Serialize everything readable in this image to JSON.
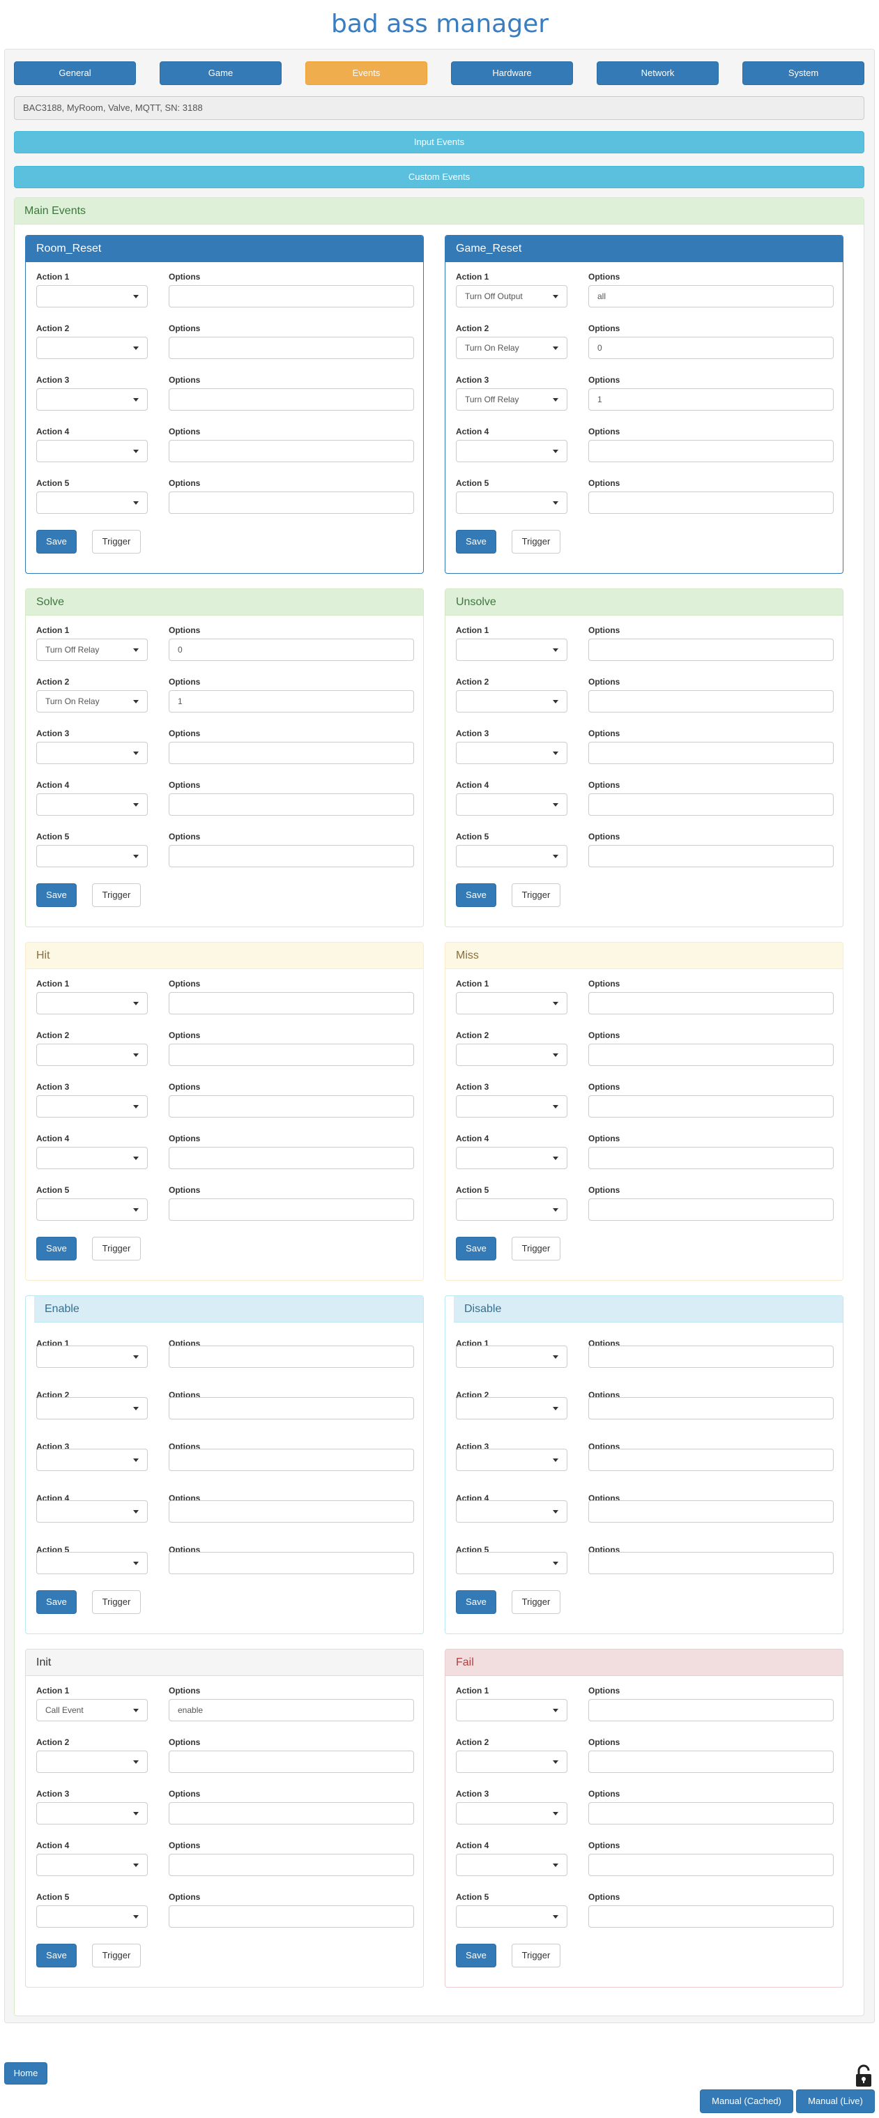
{
  "app": {
    "logo_text": "bad ass manager"
  },
  "nav": [
    "General",
    "Game",
    "Events",
    "Hardware",
    "Network",
    "System"
  ],
  "nav_active": "Events",
  "device_info": "BAC3188, MyRoom, Valve, MQTT, SN: 3188",
  "input_events_label": "Input Events",
  "custom_events_label": "Custom Events",
  "main_events_title": "Main Events",
  "labels": {
    "options": "Options",
    "save": "Save",
    "trigger": "Trigger"
  },
  "panels": [
    {
      "title": "Room_Reset",
      "actions": [
        {
          "label": "Action 1",
          "select": "",
          "option": ""
        },
        {
          "label": "Action 2",
          "select": "",
          "option": ""
        },
        {
          "label": "Action 3",
          "select": "",
          "option": ""
        },
        {
          "label": "Action 4",
          "select": "",
          "option": ""
        },
        {
          "label": "Action 5",
          "select": "",
          "option": ""
        }
      ]
    },
    {
      "title": "Game_Reset",
      "actions": [
        {
          "label": "Action 1",
          "select": "Turn Off Output",
          "option": "all"
        },
        {
          "label": "Action 2",
          "select": "Turn On Relay",
          "option": "0"
        },
        {
          "label": "Action 3",
          "select": "Turn Off Relay",
          "option": "1"
        },
        {
          "label": "Action 4",
          "select": "",
          "option": ""
        },
        {
          "label": "Action 5",
          "select": "",
          "option": ""
        }
      ]
    },
    {
      "title": "Solve",
      "actions": [
        {
          "label": "Action 1",
          "select": "Turn Off Relay",
          "option": "0"
        },
        {
          "label": "Action 2",
          "select": "Turn On Relay",
          "option": "1"
        },
        {
          "label": "Action 3",
          "select": "",
          "option": ""
        },
        {
          "label": "Action 4",
          "select": "",
          "option": ""
        },
        {
          "label": "Action 5",
          "select": "",
          "option": ""
        }
      ]
    },
    {
      "title": "Unsolve",
      "actions": [
        {
          "label": "Action 1",
          "select": "",
          "option": ""
        },
        {
          "label": "Action 2",
          "select": "",
          "option": ""
        },
        {
          "label": "Action 3",
          "select": "",
          "option": ""
        },
        {
          "label": "Action 4",
          "select": "",
          "option": ""
        },
        {
          "label": "Action 5",
          "select": "",
          "option": ""
        }
      ]
    },
    {
      "title": "Hit",
      "actions": [
        {
          "label": "Action 1",
          "select": "",
          "option": ""
        },
        {
          "label": "Action 2",
          "select": "",
          "option": ""
        },
        {
          "label": "Action 3",
          "select": "",
          "option": ""
        },
        {
          "label": "Action 4",
          "select": "",
          "option": ""
        },
        {
          "label": "Action 5",
          "select": "",
          "option": ""
        }
      ]
    },
    {
      "title": "Miss",
      "actions": [
        {
          "label": "Action 1",
          "select": "",
          "option": ""
        },
        {
          "label": "Action 2",
          "select": "",
          "option": ""
        },
        {
          "label": "Action 3",
          "select": "",
          "option": ""
        },
        {
          "label": "Action 4",
          "select": "",
          "option": ""
        },
        {
          "label": "Action 5",
          "select": "",
          "option": ""
        }
      ]
    },
    {
      "title": "Enable",
      "actions": [
        {
          "label": "Action 1",
          "select": "",
          "option": ""
        },
        {
          "label": "Action 2",
          "select": "",
          "option": ""
        },
        {
          "label": "Action 3",
          "select": "",
          "option": ""
        },
        {
          "label": "Action 4",
          "select": "",
          "option": ""
        },
        {
          "label": "Action 5",
          "select": "",
          "option": ""
        }
      ]
    },
    {
      "title": "Disable",
      "actions": [
        {
          "label": "Action 1",
          "select": "",
          "option": ""
        },
        {
          "label": "Action 2",
          "select": "",
          "option": ""
        },
        {
          "label": "Action 3",
          "select": "",
          "option": ""
        },
        {
          "label": "Action 4",
          "select": "",
          "option": ""
        },
        {
          "label": "Action 5",
          "select": "",
          "option": ""
        }
      ]
    },
    {
      "title": "Init",
      "actions": [
        {
          "label": "Action 1",
          "select": "Call Event",
          "option": "enable"
        },
        {
          "label": "Action 2",
          "select": "",
          "option": ""
        },
        {
          "label": "Action 3",
          "select": "",
          "option": ""
        },
        {
          "label": "Action 4",
          "select": "",
          "option": ""
        },
        {
          "label": "Action 5",
          "select": "",
          "option": ""
        }
      ]
    },
    {
      "title": "Fail",
      "actions": [
        {
          "label": "Action 1",
          "select": "",
          "option": ""
        },
        {
          "label": "Action 2",
          "select": "",
          "option": ""
        },
        {
          "label": "Action 3",
          "select": "",
          "option": ""
        },
        {
          "label": "Action 4",
          "select": "",
          "option": ""
        },
        {
          "label": "Action 5",
          "select": "",
          "option": ""
        }
      ]
    }
  ],
  "footer": {
    "home": "Home",
    "manual_cached": "Manual (Cached)",
    "manual_live": "Manual (Live)"
  },
  "icons": {
    "lock": "lock-icon",
    "caret": "caret-down-icon"
  },
  "colors": {
    "primary": "#337ab7",
    "active_tab": "#f0ad4e",
    "info_bar": "#5bc0de",
    "logo": "#3a7dc0"
  }
}
